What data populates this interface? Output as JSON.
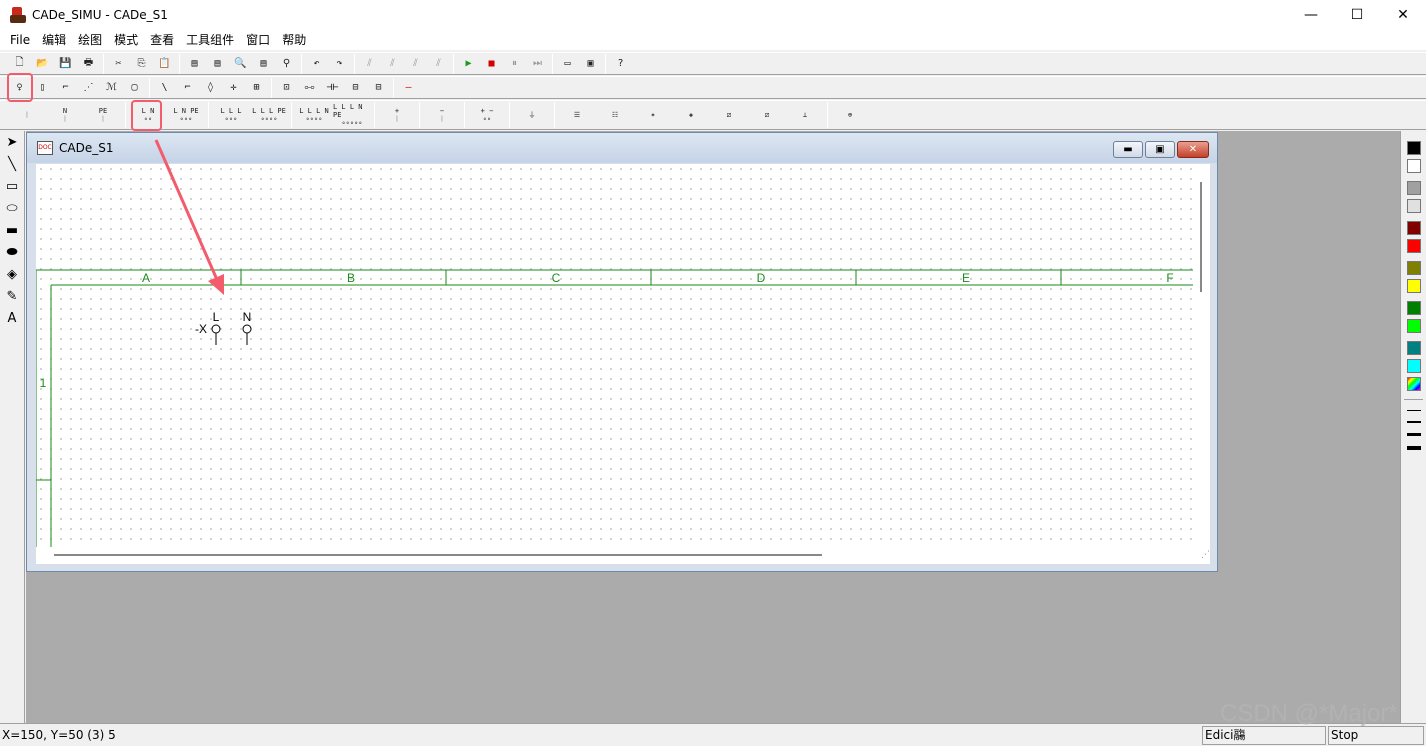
{
  "titlebar": {
    "title": "CADe_SIMU - CADe_S1",
    "minimize": "—",
    "maximize": "☐",
    "close": "✕"
  },
  "menu": [
    "File",
    "编辑",
    "绘图",
    "模式",
    "查看",
    "工具组件",
    "窗口",
    "帮助"
  ],
  "toolbar_main": [
    {
      "name": "new-icon",
      "glyph": "🗋"
    },
    {
      "name": "open-icon",
      "glyph": "📂"
    },
    {
      "name": "save-icon",
      "glyph": "💾"
    },
    {
      "name": "print-icon",
      "glyph": "🖶"
    },
    "sep",
    {
      "name": "cut-icon",
      "glyph": "✂"
    },
    {
      "name": "copy-icon",
      "glyph": "⎘"
    },
    {
      "name": "paste-icon",
      "glyph": "📋"
    },
    "sep",
    {
      "name": "page-icon-1",
      "glyph": "▤"
    },
    {
      "name": "page-icon-2",
      "glyph": "▤"
    },
    {
      "name": "zoom-icon",
      "glyph": "🔍"
    },
    {
      "name": "page-icon-3",
      "glyph": "▤"
    },
    {
      "name": "find-icon",
      "glyph": "⚲"
    },
    "sep",
    {
      "name": "undo-icon",
      "glyph": "↶"
    },
    {
      "name": "redo-icon",
      "glyph": "↷"
    },
    "sep",
    {
      "name": "align-icon-1",
      "glyph": "⫽",
      "tone": "gray"
    },
    {
      "name": "align-icon-2",
      "glyph": "⫽",
      "tone": "gray"
    },
    {
      "name": "align-icon-3",
      "glyph": "⫽",
      "tone": "gray"
    },
    {
      "name": "align-icon-4",
      "glyph": "⫽",
      "tone": "gray"
    },
    "sep",
    {
      "name": "play-icon",
      "glyph": "▶",
      "tone": "green"
    },
    {
      "name": "stop-icon",
      "glyph": "■",
      "tone": "red"
    },
    {
      "name": "pause-icon",
      "glyph": "⏸",
      "tone": "gray"
    },
    {
      "name": "step-icon",
      "glyph": "⏭",
      "tone": "gray"
    },
    "sep",
    {
      "name": "window-icon-1",
      "glyph": "▭"
    },
    {
      "name": "window-icon-2",
      "glyph": "▣"
    },
    "sep",
    {
      "name": "help-icon",
      "glyph": "?"
    }
  ],
  "toolbar_components": [
    {
      "name": "terminal-icon",
      "glyph": "♀",
      "highlight": true
    },
    {
      "name": "fuse-icon",
      "glyph": "▯"
    },
    {
      "name": "switch-icon",
      "glyph": "⌐"
    },
    {
      "name": "triple-switch-icon",
      "glyph": "⋰"
    },
    {
      "name": "motor-icon",
      "glyph": "ℳ"
    },
    {
      "name": "coil-icon",
      "glyph": "▢"
    },
    "sep",
    {
      "name": "contact-no-icon",
      "glyph": "\\"
    },
    {
      "name": "contact-nc-icon",
      "glyph": "⌐"
    },
    {
      "name": "diode-icon",
      "glyph": "◊"
    },
    {
      "name": "cross-icon",
      "glyph": "✛"
    },
    {
      "name": "box-icon",
      "glyph": "⊞"
    },
    "sep",
    {
      "name": "relay-icon",
      "glyph": "⊡"
    },
    {
      "name": "resistor-icon",
      "glyph": "⧟"
    },
    {
      "name": "capacitor-icon",
      "glyph": "⊣⊢"
    },
    {
      "name": "io-icon",
      "glyph": "⊟"
    },
    {
      "name": "plc-icon",
      "glyph": "⊟"
    },
    "sep",
    {
      "name": "wire-icon",
      "glyph": "—",
      "tone": "red"
    }
  ],
  "toolbar_power": [
    {
      "name": "phase-icon",
      "glyph": "ᛁ",
      "label": ""
    },
    {
      "name": "neutral-icon",
      "glyph": "ᛁ",
      "label": "N"
    },
    {
      "name": "pe-icon",
      "glyph": "ᛁ",
      "label": "PE"
    },
    "sep",
    {
      "name": "ln-icon",
      "glyph": "∘∘",
      "label": "L N",
      "highlight": true
    },
    {
      "name": "lnpe-icon",
      "glyph": "∘∘∘",
      "label": "L N PE"
    },
    "sep",
    {
      "name": "lll-icon",
      "glyph": "∘∘∘",
      "label": "L L L"
    },
    {
      "name": "lllpe-icon",
      "glyph": "∘∘∘∘",
      "label": "L L L PE"
    },
    "sep",
    {
      "name": "llln-icon",
      "glyph": "∘∘∘∘",
      "label": "L L L N"
    },
    {
      "name": "lllnpe-icon",
      "glyph": "∘∘∘∘∘",
      "label": "L L L N PE"
    },
    "sep",
    {
      "name": "plus-icon",
      "glyph": "ᛁ",
      "label": "+"
    },
    "sep",
    {
      "name": "minus-icon",
      "glyph": "ᛁ",
      "label": "−"
    },
    "sep",
    {
      "name": "dc-icon",
      "glyph": "∘∘",
      "label": "+ −"
    },
    "sep",
    {
      "name": "ground-icon",
      "glyph": "⏚",
      "label": ""
    },
    "sep",
    {
      "name": "busbar-icon-1",
      "glyph": "☰",
      "label": ""
    },
    {
      "name": "busbar-icon-2",
      "glyph": "☷",
      "label": ""
    },
    {
      "name": "junction-icon",
      "glyph": "✶",
      "label": ""
    },
    {
      "name": "diamond-icon",
      "glyph": "◈",
      "label": ""
    },
    {
      "name": "source-icon-1",
      "glyph": "⧄",
      "label": ""
    },
    {
      "name": "source-icon-2",
      "glyph": "⧄",
      "label": ""
    },
    {
      "name": "battery-icon",
      "glyph": "⊥",
      "label": ""
    },
    "sep",
    {
      "name": "motor-source-icon",
      "glyph": "⊕",
      "label": ""
    }
  ],
  "left_tools": [
    {
      "name": "select-arrow-icon",
      "glyph": "➤"
    },
    {
      "name": "line-tool-icon",
      "glyph": "╲"
    },
    {
      "name": "rectangle-tool-icon",
      "glyph": "▭"
    },
    {
      "name": "ellipse-tool-icon",
      "glyph": "⬭"
    },
    {
      "name": "filled-rectangle-tool-icon",
      "glyph": "▬"
    },
    {
      "name": "filled-ellipse-tool-icon",
      "glyph": "⬬"
    },
    {
      "name": "fill-bucket-icon",
      "glyph": "◈"
    },
    {
      "name": "pen-tool-icon",
      "glyph": "✎"
    },
    {
      "name": "text-tool-icon",
      "glyph": "A"
    }
  ],
  "colors": [
    "#000000",
    "#ffffff",
    "#a0a0a0",
    "#e0e0e0",
    "#800000",
    "#ff0000",
    "#808000",
    "#ffff00",
    "#008000",
    "#00ff00",
    "#008080",
    "#00ffff"
  ],
  "line_widths": [
    1,
    2,
    3,
    4
  ],
  "child_window": {
    "title": "CADe_S1",
    "doc_icon": "DOC",
    "minimize": "▬",
    "restore": "▣",
    "close": "✕"
  },
  "sheet": {
    "columns": [
      "A",
      "B",
      "C",
      "D",
      "E",
      "F"
    ],
    "row_label": "1",
    "component": {
      "ref": "-X",
      "terminals": [
        "L",
        "N"
      ]
    },
    "border_color": "#1a8a1a",
    "annotation_color": "#f25c6c"
  },
  "status": {
    "coords": "X=150, Y=50 (3) 5",
    "mode": "Edici鬺",
    "run_state": "Stop"
  },
  "watermark": "CSDN @*Major*"
}
